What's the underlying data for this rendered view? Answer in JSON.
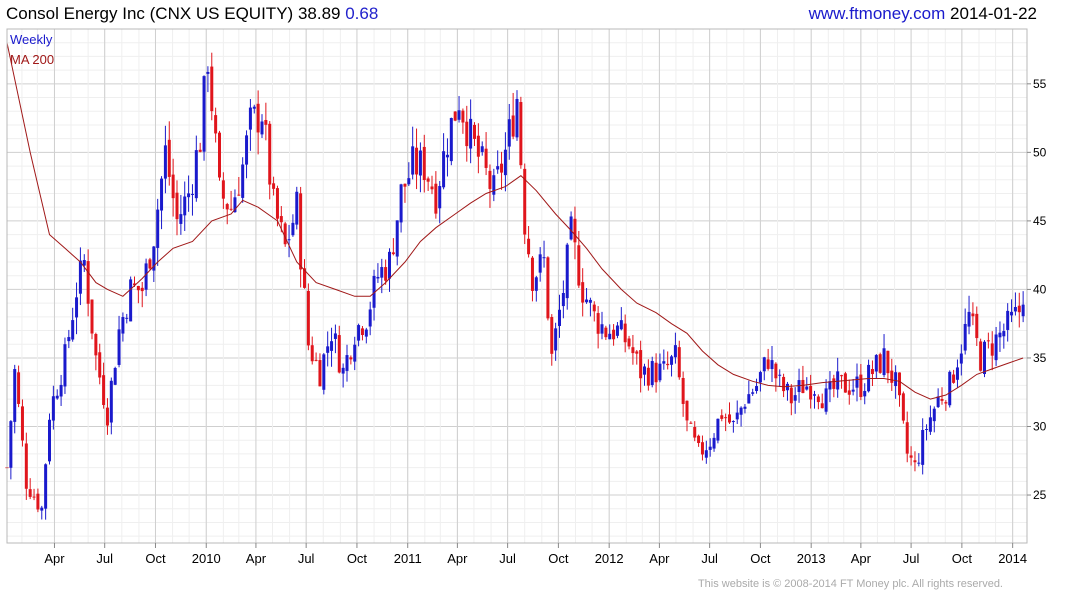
{
  "header": {
    "company": "Consol Energy Inc (CNX US EQUITY)",
    "price": "38.89",
    "change": "0.68",
    "site": "www.ftmoney.com",
    "date": "2014-01-22"
  },
  "footer": {
    "copyright": "This website is © 2008-2014 FT Money plc. All rights reserved."
  },
  "colors": {
    "up": "#1a1acc",
    "down": "#e0151c",
    "ma": "#a01818",
    "grid": "#d9d9d9",
    "frame": "#b8b8b8"
  },
  "chart_data": {
    "type": "candlestick",
    "legend": [
      {
        "label": "Weekly",
        "color": "#1a1acc"
      },
      {
        "label": "MA 200",
        "color": "#a01818"
      }
    ],
    "ylim": [
      21.5,
      59
    ],
    "y_ticks": [
      25,
      30,
      35,
      40,
      45,
      50,
      55
    ],
    "x_range": [
      "2009-01-05",
      "2014-01-27"
    ],
    "x_ticks": [
      {
        "label": "Apr",
        "date": "2009-04-01"
      },
      {
        "label": "Jul",
        "date": "2009-07-01"
      },
      {
        "label": "Oct",
        "date": "2009-10-01"
      },
      {
        "label": "2010",
        "date": "2010-01-01"
      },
      {
        "label": "Apr",
        "date": "2010-04-01"
      },
      {
        "label": "Jul",
        "date": "2010-07-01"
      },
      {
        "label": "Oct",
        "date": "2010-10-01"
      },
      {
        "label": "2011",
        "date": "2011-01-01"
      },
      {
        "label": "Apr",
        "date": "2011-04-01"
      },
      {
        "label": "Jul",
        "date": "2011-07-01"
      },
      {
        "label": "Oct",
        "date": "2011-10-01"
      },
      {
        "label": "2012",
        "date": "2012-01-01"
      },
      {
        "label": "Apr",
        "date": "2012-04-01"
      },
      {
        "label": "Jul",
        "date": "2012-07-01"
      },
      {
        "label": "Oct",
        "date": "2012-10-01"
      },
      {
        "label": "2013",
        "date": "2013-01-01"
      },
      {
        "label": "Apr",
        "date": "2013-04-01"
      },
      {
        "label": "Jul",
        "date": "2013-07-01"
      },
      {
        "label": "Oct",
        "date": "2013-10-01"
      },
      {
        "label": "2014",
        "date": "2014-01-01"
      }
    ],
    "price_path": [
      [
        "2009-01-05",
        27
      ],
      [
        "2009-01-19",
        34
      ],
      [
        "2009-02-09",
        26
      ],
      [
        "2009-03-09",
        24
      ],
      [
        "2009-03-23",
        31
      ],
      [
        "2009-04-20",
        35
      ],
      [
        "2009-05-11",
        40
      ],
      [
        "2009-05-25",
        42
      ],
      [
        "2009-06-15",
        35
      ],
      [
        "2009-07-06",
        31
      ],
      [
        "2009-07-27",
        37
      ],
      [
        "2009-08-17",
        40
      ],
      [
        "2009-09-07",
        40
      ],
      [
        "2009-09-28",
        44
      ],
      [
        "2009-10-19",
        50
      ],
      [
        "2009-11-09",
        45
      ],
      [
        "2009-11-30",
        47
      ],
      [
        "2009-12-21",
        51
      ],
      [
        "2010-01-04",
        57
      ],
      [
        "2010-01-25",
        47
      ],
      [
        "2010-02-15",
        46
      ],
      [
        "2010-03-08",
        49
      ],
      [
        "2010-03-22",
        52
      ],
      [
        "2010-04-12",
        53
      ],
      [
        "2010-05-03",
        46
      ],
      [
        "2010-05-24",
        43
      ],
      [
        "2010-06-14",
        46
      ],
      [
        "2010-07-05",
        36
      ],
      [
        "2010-07-26",
        34
      ],
      [
        "2010-08-16",
        37
      ],
      [
        "2010-09-06",
        34
      ],
      [
        "2010-09-27",
        37
      ],
      [
        "2010-10-18",
        38
      ],
      [
        "2010-11-08",
        41
      ],
      [
        "2010-11-29",
        42
      ],
      [
        "2010-12-20",
        47
      ],
      [
        "2011-01-10",
        49
      ],
      [
        "2011-01-31",
        49
      ],
      [
        "2011-02-21",
        47
      ],
      [
        "2011-03-14",
        51
      ],
      [
        "2011-04-04",
        54
      ],
      [
        "2011-04-25",
        51
      ],
      [
        "2011-05-16",
        49
      ],
      [
        "2011-06-06",
        47
      ],
      [
        "2011-06-27",
        50
      ],
      [
        "2011-07-18",
        54
      ],
      [
        "2011-08-01",
        45
      ],
      [
        "2011-08-15",
        41
      ],
      [
        "2011-09-05",
        42
      ],
      [
        "2011-09-19",
        35
      ],
      [
        "2011-10-10",
        40
      ],
      [
        "2011-10-24",
        44
      ],
      [
        "2011-11-14",
        40
      ],
      [
        "2011-12-05",
        38
      ],
      [
        "2011-12-26",
        37
      ],
      [
        "2012-01-16",
        37
      ],
      [
        "2012-02-06",
        36
      ],
      [
        "2012-02-27",
        34
      ],
      [
        "2012-03-19",
        34
      ],
      [
        "2012-04-09",
        34
      ],
      [
        "2012-04-30",
        35
      ],
      [
        "2012-05-21",
        30
      ],
      [
        "2012-06-11",
        28
      ],
      [
        "2012-07-02",
        29
      ],
      [
        "2012-07-23",
        31
      ],
      [
        "2012-08-13",
        30
      ],
      [
        "2012-09-03",
        32
      ],
      [
        "2012-09-24",
        33
      ],
      [
        "2012-10-15",
        35
      ],
      [
        "2012-11-05",
        33
      ],
      [
        "2012-11-26",
        32
      ],
      [
        "2012-12-17",
        33
      ],
      [
        "2013-01-07",
        33
      ],
      [
        "2013-01-28",
        32
      ],
      [
        "2013-02-18",
        33
      ],
      [
        "2013-03-11",
        33
      ],
      [
        "2013-04-01",
        33
      ],
      [
        "2013-04-22",
        34
      ],
      [
        "2013-05-13",
        35
      ],
      [
        "2013-06-03",
        33
      ],
      [
        "2013-06-24",
        28
      ],
      [
        "2013-07-08",
        27
      ],
      [
        "2013-07-29",
        30
      ],
      [
        "2013-08-19",
        32
      ],
      [
        "2013-09-09",
        33
      ],
      [
        "2013-09-30",
        36
      ],
      [
        "2013-10-14",
        38
      ],
      [
        "2013-11-04",
        35
      ],
      [
        "2013-11-25",
        36
      ],
      [
        "2013-12-16",
        37
      ],
      [
        "2014-01-06",
        38
      ],
      [
        "2014-01-20",
        38.89
      ]
    ],
    "ma200": [
      [
        "2009-01-05",
        58
      ],
      [
        "2009-02-16",
        50
      ],
      [
        "2009-03-23",
        44
      ],
      [
        "2009-04-20",
        43
      ],
      [
        "2009-05-18",
        42
      ],
      [
        "2009-06-15",
        40.5
      ],
      [
        "2009-07-06",
        40
      ],
      [
        "2009-08-03",
        39.5
      ],
      [
        "2009-09-07",
        40.8
      ],
      [
        "2009-10-05",
        42
      ],
      [
        "2009-11-02",
        43
      ],
      [
        "2009-12-07",
        43.5
      ],
      [
        "2010-01-11",
        45
      ],
      [
        "2010-02-15",
        45.5
      ],
      [
        "2010-03-08",
        46.5
      ],
      [
        "2010-04-05",
        46
      ],
      [
        "2010-05-10",
        45
      ],
      [
        "2010-06-14",
        42
      ],
      [
        "2010-07-19",
        40.5
      ],
      [
        "2010-08-23",
        40
      ],
      [
        "2010-09-27",
        39.5
      ],
      [
        "2010-10-25",
        39.5
      ],
      [
        "2010-11-22",
        40.5
      ],
      [
        "2010-12-27",
        42
      ],
      [
        "2011-01-24",
        43.5
      ],
      [
        "2011-02-21",
        44.5
      ],
      [
        "2011-03-28",
        45.5
      ],
      [
        "2011-04-25",
        46.3
      ],
      [
        "2011-05-23",
        47
      ],
      [
        "2011-06-27",
        47.5
      ],
      [
        "2011-07-25",
        48.3
      ],
      [
        "2011-08-22",
        47.2
      ],
      [
        "2011-09-26",
        45.5
      ],
      [
        "2011-10-24",
        44.3
      ],
      [
        "2011-11-21",
        43
      ],
      [
        "2011-12-19",
        41.5
      ],
      [
        "2012-01-23",
        40
      ],
      [
        "2012-02-20",
        39
      ],
      [
        "2012-03-26",
        38.3
      ],
      [
        "2012-04-23",
        37.5
      ],
      [
        "2012-05-21",
        36.8
      ],
      [
        "2012-06-18",
        35.5
      ],
      [
        "2012-07-16",
        34.5
      ],
      [
        "2012-08-13",
        33.8
      ],
      [
        "2012-09-17",
        33.3
      ],
      [
        "2012-10-15",
        33
      ],
      [
        "2012-11-12",
        32.9
      ],
      [
        "2012-12-17",
        33
      ],
      [
        "2013-01-21",
        33.2
      ],
      [
        "2013-02-18",
        33.3
      ],
      [
        "2013-03-18",
        33.4
      ],
      [
        "2013-04-15",
        33.5
      ],
      [
        "2013-05-13",
        33.5
      ],
      [
        "2013-06-10",
        33.3
      ],
      [
        "2013-07-08",
        32.5
      ],
      [
        "2013-08-05",
        32
      ],
      [
        "2013-09-02",
        32.3
      ],
      [
        "2013-09-30",
        33
      ],
      [
        "2013-10-28",
        33.8
      ],
      [
        "2013-11-25",
        34.2
      ],
      [
        "2013-12-23",
        34.6
      ],
      [
        "2014-01-20",
        35
      ]
    ]
  }
}
